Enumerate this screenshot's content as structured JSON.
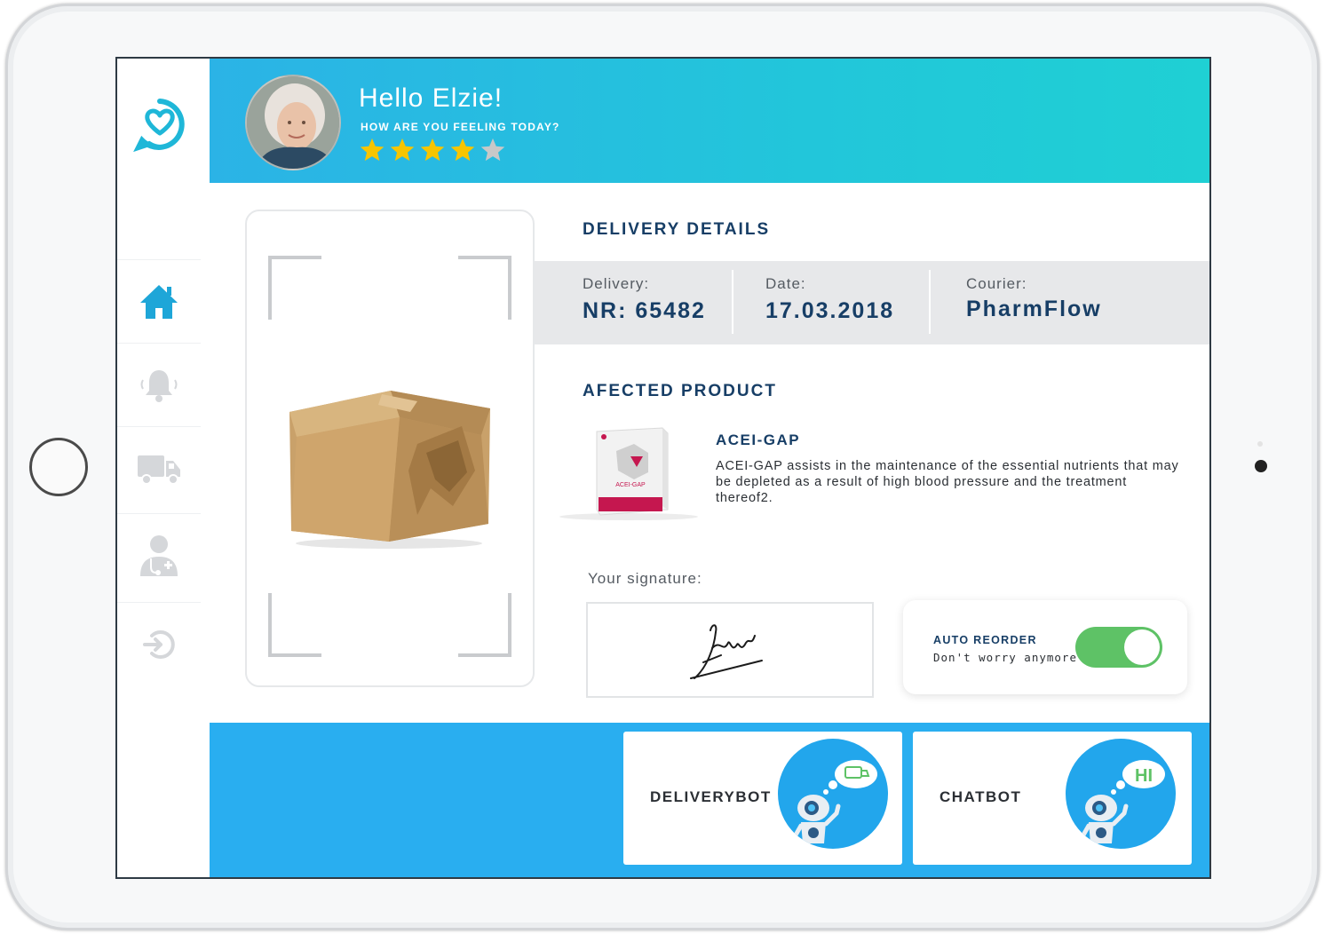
{
  "header": {
    "greeting": "Hello Elzie!",
    "subtitle": "HOW ARE YOU FEELING TODAY?",
    "rating": 4,
    "rating_max": 5
  },
  "sidebar": {
    "items": [
      {
        "icon": "home-icon",
        "active": true
      },
      {
        "icon": "bell-icon",
        "active": false
      },
      {
        "icon": "truck-icon",
        "active": false
      },
      {
        "icon": "doctor-icon",
        "active": false
      },
      {
        "icon": "logout-icon",
        "active": false
      }
    ]
  },
  "delivery": {
    "title": "DELIVERY DETAILS",
    "delivery_label": "Delivery:",
    "delivery_value": "NR: 65482",
    "date_label": "Date:",
    "date_value": "17.03.2018",
    "courier_label": "Courier:",
    "courier_value": "PharmFlow"
  },
  "product": {
    "title": "AFECTED PRODUCT",
    "name": "ACEI-GAP",
    "description": "ACEI-GAP assists in the maintenance of the essential nutrients that may be depleted as a result of high blood pressure and the treatment thereof2.",
    "package_text": "ACEI-GAP"
  },
  "signature": {
    "label": "Your signature:"
  },
  "auto_reorder": {
    "title": "AUTO REORDER",
    "subtitle": "Don't worry anymore",
    "enabled": true
  },
  "bots": {
    "delivery_label": "DELIVERYBOT",
    "chat_label": "CHATBOT",
    "chat_bubble": "HI"
  },
  "colors": {
    "header_start": "#2bb3e6",
    "header_end": "#1fd0d4",
    "accent": "#22c6da",
    "navy": "#173e66",
    "footer": "#29aef0",
    "toggle_on": "#5ec266",
    "star_on": "#f7c500",
    "star_off": "#c8c8c8"
  }
}
